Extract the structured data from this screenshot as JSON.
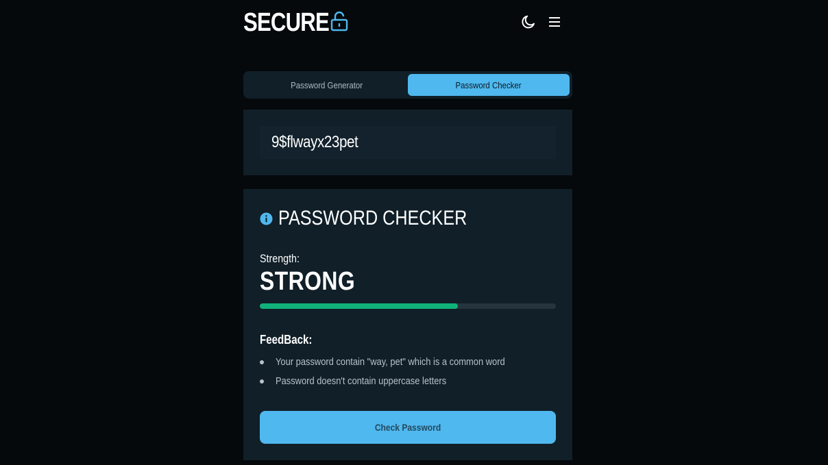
{
  "app": {
    "logo_text": "SECURE",
    "logo_icon": "unlocked-padlock-icon",
    "accent_color": "#4fb8ee"
  },
  "header": {
    "theme_toggle_icon": "moon-icon",
    "menu_icon": "hamburger-menu-icon"
  },
  "tabs": [
    {
      "label": "Password Generator",
      "active": false
    },
    {
      "label": "Password Checker",
      "active": true
    }
  ],
  "password_input": {
    "value": "9$flwayx23pet"
  },
  "checker": {
    "title": "PASSWORD CHECKER",
    "title_icon": "info-icon",
    "strength_label": "Strength:",
    "strength_value": "STRONG",
    "strength_progress_percent": 67,
    "strength_color": "#10b27a",
    "feedback_title": "FeedBack:",
    "feedback_items": [
      "Your password contain \"way, pet\" which is a common word",
      "Password doesn't contain uppercase letters"
    ],
    "check_button_label": "Check Password"
  }
}
